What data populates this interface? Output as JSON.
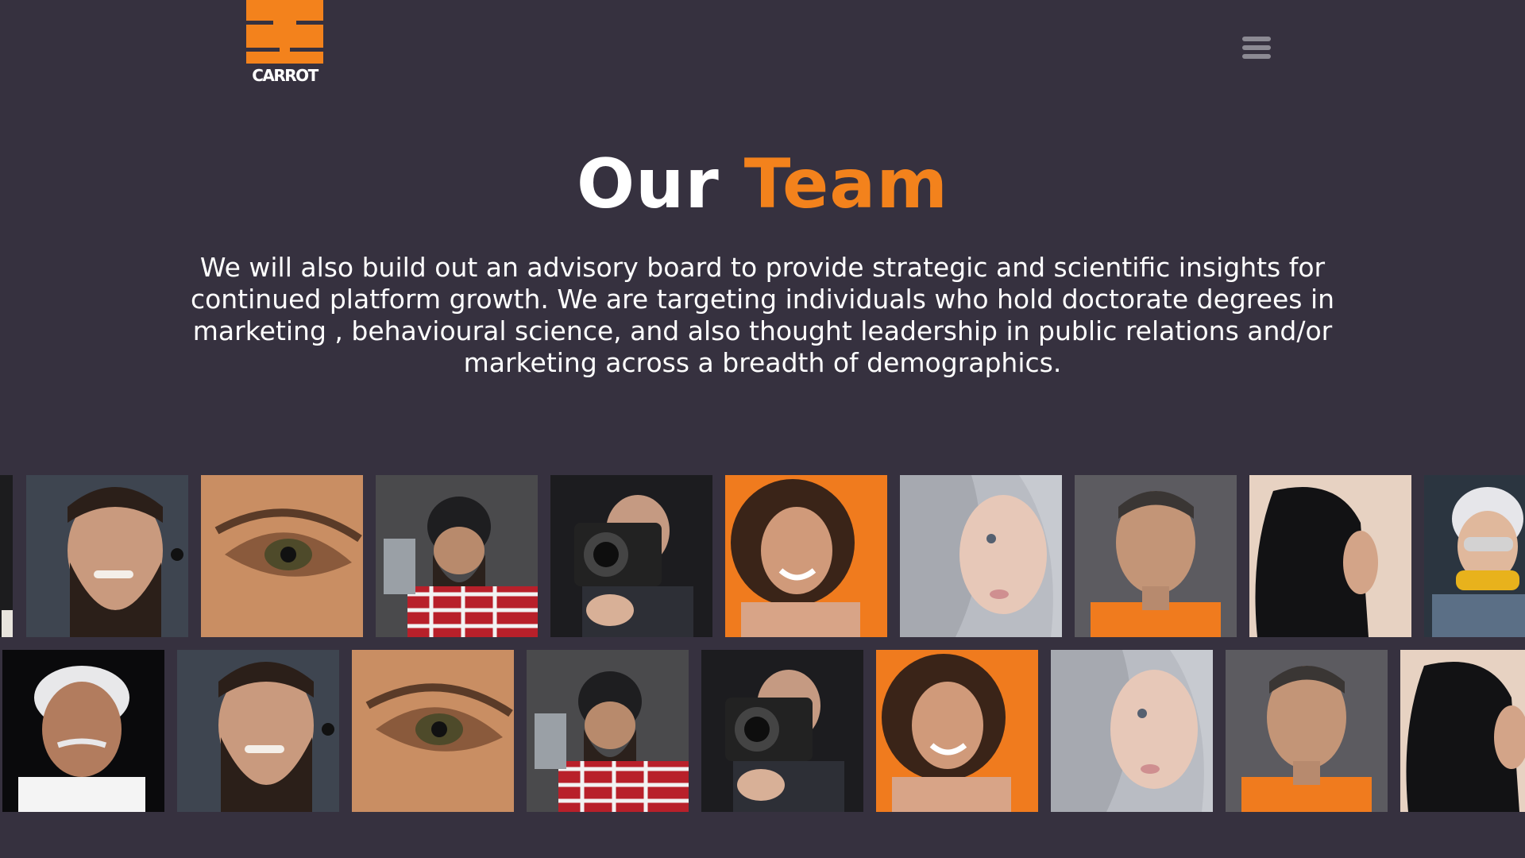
{
  "brand": {
    "logo_text": "CARROT",
    "accent_color": "#f3821c",
    "background_color": "#36313f"
  },
  "header": {
    "menu_icon": "hamburger-menu-icon"
  },
  "main": {
    "title_part1": "Our",
    "title_part2": "Team",
    "description": "We will also build out an advisory board to provide strategic and scientific insights for continued platform growth. We are targeting individuals who hold doctorate degrees in marketing , behavioural science, and also thought leadership in public relations and/or marketing across a breadth of demographics."
  },
  "gallery": {
    "row1": [
      "portrait-bearded-man-smiling",
      "portrait-eye-closeup",
      "portrait-man-beanie-axe",
      "portrait-photographer-camera",
      "portrait-curly-hair-woman-orange",
      "portrait-silver-hair-woman",
      "portrait-man-orange-shirt",
      "portrait-woman-hijab-profile",
      "portrait-worker-safety-glasses"
    ],
    "row2": [
      "portrait-elderly-man-white-hair",
      "portrait-bearded-man-smiling",
      "portrait-eye-closeup",
      "portrait-man-beanie-axe",
      "portrait-photographer-camera",
      "portrait-curly-hair-woman-orange",
      "portrait-silver-hair-woman",
      "portrait-man-orange-shirt",
      "portrait-woman-hijab-profile"
    ]
  }
}
